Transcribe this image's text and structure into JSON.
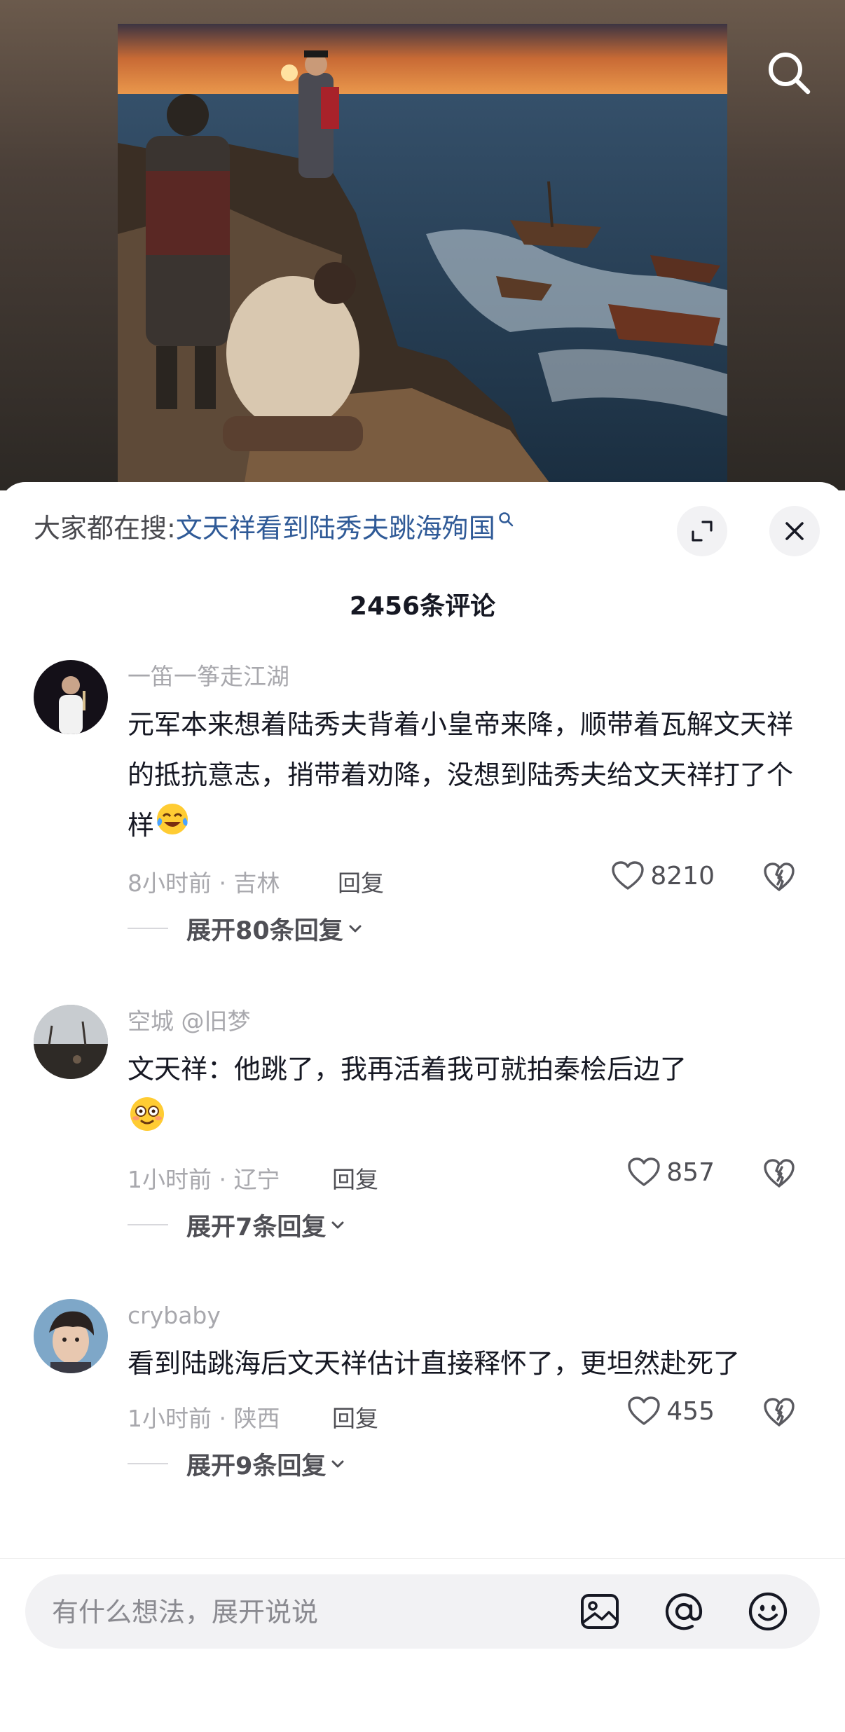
{
  "hot_search": {
    "prefix": "大家都在搜:",
    "query": "文天祥看到陆秀夫跳海殉国"
  },
  "comment_count": "2456条评论",
  "comments": [
    {
      "username": "一笛一筝走江湖",
      "text": "元军本来想着陆秀夫背着小皇帝来降，顺带着瓦解文天祥的抵抗意志，捎带着劝降，没想到陆秀夫给文天祥打了个样",
      "emoji": "laughing-crying-emoji",
      "time_location": "8小时前 · 吉林",
      "reply_label": "回复",
      "likes": "8210",
      "expand_label": "展开80条回复"
    },
    {
      "username": "空城 @旧梦",
      "text": "文天祥：他跳了，我再活着我可就拍秦桧后边了",
      "emoji": "dazed-face-emoji",
      "time_location": "1小时前 · 辽宁",
      "reply_label": "回复",
      "likes": "857",
      "expand_label": "展开7条回复"
    },
    {
      "username": "crybaby",
      "text": "看到陆跳海后文天祥估计直接释怀了，更坦然赴死了",
      "emoji": "",
      "time_location": "1小时前 · 陕西",
      "reply_label": "回复",
      "likes": "455",
      "expand_label": "展开9条回复"
    }
  ],
  "input": {
    "placeholder": "有什么想法，展开说说"
  },
  "icons": {
    "top_right": "search-icon",
    "sheet_buttons": [
      "expand-icon",
      "close-icon"
    ],
    "input_bar": [
      "image-icon",
      "at-icon",
      "emoji-icon"
    ],
    "comment_actions": [
      "heart-icon",
      "broken-heart-icon"
    ]
  },
  "colors": {
    "accent_link": "#2f5a97",
    "text_primary": "#161823",
    "text_secondary": "#a8a8ad"
  }
}
